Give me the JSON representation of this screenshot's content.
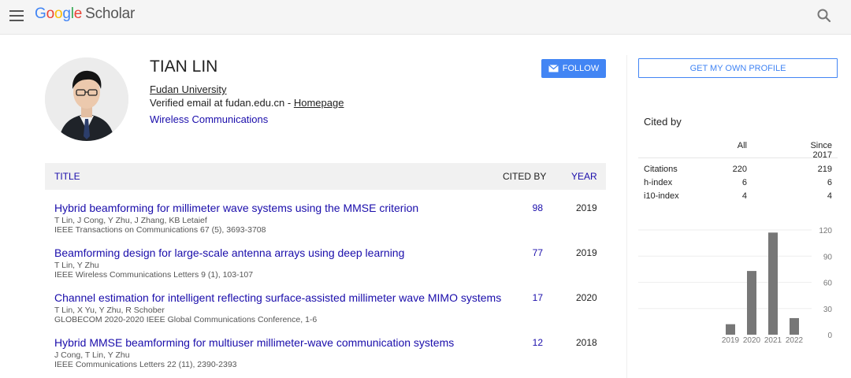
{
  "header": {
    "logo_google": "Google",
    "logo_scholar": "Scholar",
    "colors": {
      "blue": "#4285f4",
      "red": "#ea4335",
      "yellow": "#fbbc05",
      "green": "#34a853"
    }
  },
  "profile": {
    "name": "TIAN LIN",
    "affiliation": "Fudan University",
    "email_prefix": "Verified email at fudan.edu.cn - ",
    "homepage_label": "Homepage",
    "interest": "Wireless Communications",
    "follow_label": "FOLLOW"
  },
  "table": {
    "headers": {
      "title": "TITLE",
      "cited_by": "CITED BY",
      "year": "YEAR"
    },
    "rows": [
      {
        "title": "Hybrid beamforming for millimeter wave systems using the MMSE criterion",
        "authors": "T Lin, J Cong, Y Zhu, J Zhang, KB Letaief",
        "venue": "IEEE Transactions on Communications 67 (5), 3693-3708",
        "cited": "98",
        "year": "2019"
      },
      {
        "title": "Beamforming design for large-scale antenna arrays using deep learning",
        "authors": "T Lin, Y Zhu",
        "venue": "IEEE Wireless Communications Letters 9 (1), 103-107",
        "cited": "77",
        "year": "2019"
      },
      {
        "title": "Channel estimation for intelligent reflecting surface-assisted millimeter wave MIMO systems",
        "authors": "T Lin, X Yu, Y Zhu, R Schober",
        "venue": "GLOBECOM 2020-2020 IEEE Global Communications Conference, 1-6",
        "cited": "17",
        "year": "2020"
      },
      {
        "title": "Hybrid MMSE beamforming for multiuser millimeter-wave communication systems",
        "authors": "J Cong, T Lin, Y Zhu",
        "venue": "IEEE Communications Letters 22 (11), 2390-2393",
        "cited": "12",
        "year": "2018"
      }
    ]
  },
  "sidebar": {
    "own_profile_label": "GET MY OWN PROFILE",
    "cited_by_label": "Cited by",
    "col_all": "All",
    "col_since": "Since 2017",
    "stats": [
      {
        "label": "Citations",
        "all": "220",
        "since": "219"
      },
      {
        "label": "h-index",
        "all": "6",
        "since": "6"
      },
      {
        "label": "i10-index",
        "all": "4",
        "since": "4"
      }
    ]
  },
  "chart_data": {
    "type": "bar",
    "categories": [
      "2019",
      "2020",
      "2021",
      "2022"
    ],
    "values": [
      12,
      73,
      117,
      19
    ],
    "ylim": [
      0,
      120
    ],
    "yticks": [
      0,
      30,
      60,
      90,
      120
    ],
    "color": "#777777",
    "grid": true
  }
}
